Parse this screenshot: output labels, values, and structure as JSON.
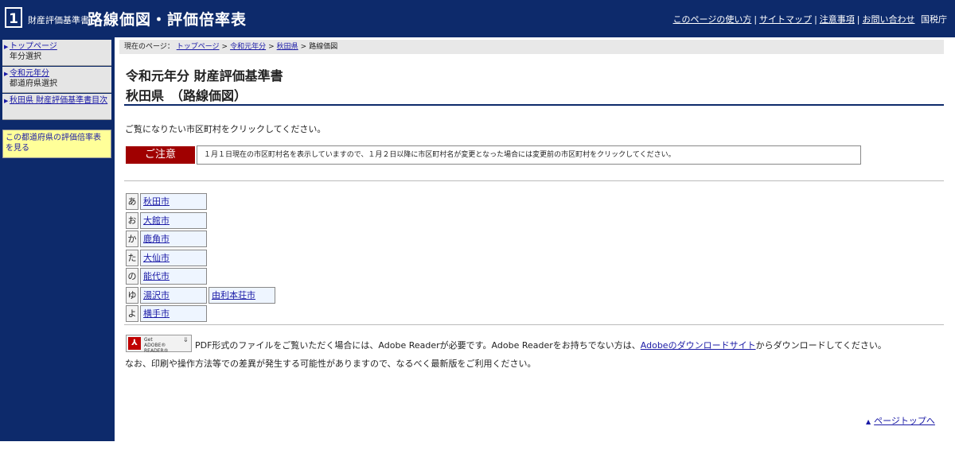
{
  "header": {
    "logo_number": "1",
    "site_small": "財産評価基準書",
    "site_title": "路線価図・評価倍率表",
    "nav": {
      "howto": "このページの使い方",
      "sitemap": "サイトマップ",
      "notes": "注意事項",
      "contact": "お問い合わせ",
      "agency": "国税庁"
    }
  },
  "sidebar": {
    "items": [
      {
        "link": "トップページ",
        "sub": "年分選択"
      },
      {
        "link": "令和元年分",
        "sub": "都道府県選択"
      },
      {
        "link": "秋田県 財産評価基準書目次",
        "sub": ""
      }
    ],
    "yellow": "この都道府県の評価倍率表を見る"
  },
  "breadcrumb": {
    "label": "現在のページ：",
    "items": [
      "トップページ",
      "令和元年分",
      "秋田県"
    ],
    "current": "路線価図"
  },
  "main": {
    "heading1": "令和元年分 財産評価基準書",
    "heading2": "秋田県　（路線価図）",
    "intro": "ご覧になりたい市区町村をクリックしてください。",
    "notice_tag": "ご注意",
    "notice_text": "１月１日現在の市区町村名を表示していますので、１月２日以降に市区町村名が変更となった場合には変更前の市区町村をクリックしてください。"
  },
  "cities": [
    {
      "kana": "あ",
      "names": [
        "秋田市"
      ]
    },
    {
      "kana": "お",
      "names": [
        "大館市"
      ]
    },
    {
      "kana": "か",
      "names": [
        "鹿角市"
      ]
    },
    {
      "kana": "た",
      "names": [
        "大仙市"
      ]
    },
    {
      "kana": "の",
      "names": [
        "能代市"
      ]
    },
    {
      "kana": "ゆ",
      "names": [
        "湯沢市",
        "由利本荘市"
      ]
    },
    {
      "kana": "よ",
      "names": [
        "横手市"
      ]
    }
  ],
  "adobe": {
    "badge_get": "Get",
    "badge_reader": "ADOBE® READER®",
    "text_before": "PDF形式のファイルをご覧いただく場合には、Adobe Readerが必要です。Adobe Readerをお持ちでない方は、",
    "link": "Adobeのダウンロードサイト",
    "text_after": "からダウンロードしてください。",
    "text2": "なお、印刷や操作方法等での差異が発生する可能性がありますので、なるべく最新版をご利用ください。"
  },
  "footer": {
    "pagetop": "ページトップへ"
  },
  "colors": {
    "navy": "#0d2a6b",
    "notice_red": "#a00000",
    "sidebar_yellow": "#ffff99"
  }
}
